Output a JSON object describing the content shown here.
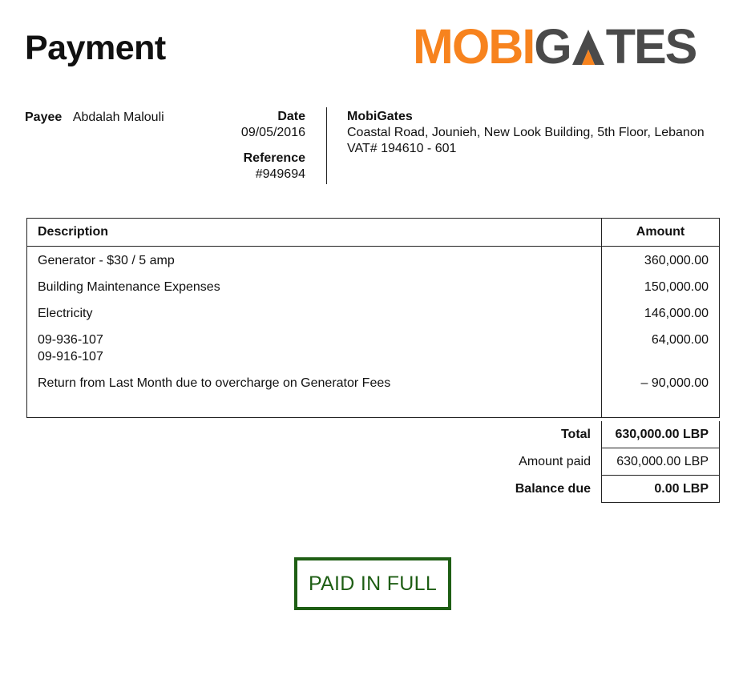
{
  "header": {
    "title": "Payment"
  },
  "logo": {
    "part1": "MOBI",
    "part2": "G",
    "part3": "TES",
    "accent_color": "#F7831E",
    "dark_color": "#4A4A4A"
  },
  "payee": {
    "label": "Payee",
    "name": "Abdalah Malouli"
  },
  "meta": {
    "date_label": "Date",
    "date": "09/05/2016",
    "reference_label": "Reference",
    "reference": "#949694"
  },
  "company": {
    "name": "MobiGates",
    "address": "Coastal Road, Jounieh, New Look Building, 5th Floor, Lebanon",
    "vat": "VAT# 194610 - 601"
  },
  "table": {
    "headers": {
      "description": "Description",
      "amount": "Amount"
    },
    "rows": [
      {
        "description": "Generator - $30 / 5 amp",
        "amount": "360,000.00"
      },
      {
        "description": "Building Maintenance Expenses",
        "amount": "150,000.00"
      },
      {
        "description": "Electricity",
        "amount": "146,000.00"
      },
      {
        "description": "09-936-107",
        "description2": "09-916-107",
        "amount": "64,000.00"
      },
      {
        "description": "Return from Last Month due to overcharge on Generator Fees",
        "amount": "– 90,000.00"
      }
    ]
  },
  "totals": {
    "total_label": "Total",
    "total": "630,000.00 LBP",
    "paid_label": "Amount paid",
    "paid": "630,000.00 LBP",
    "balance_label": "Balance due",
    "balance": "0.00 LBP"
  },
  "stamp": {
    "text": "PAID IN FULL",
    "color": "#1E5E14"
  }
}
